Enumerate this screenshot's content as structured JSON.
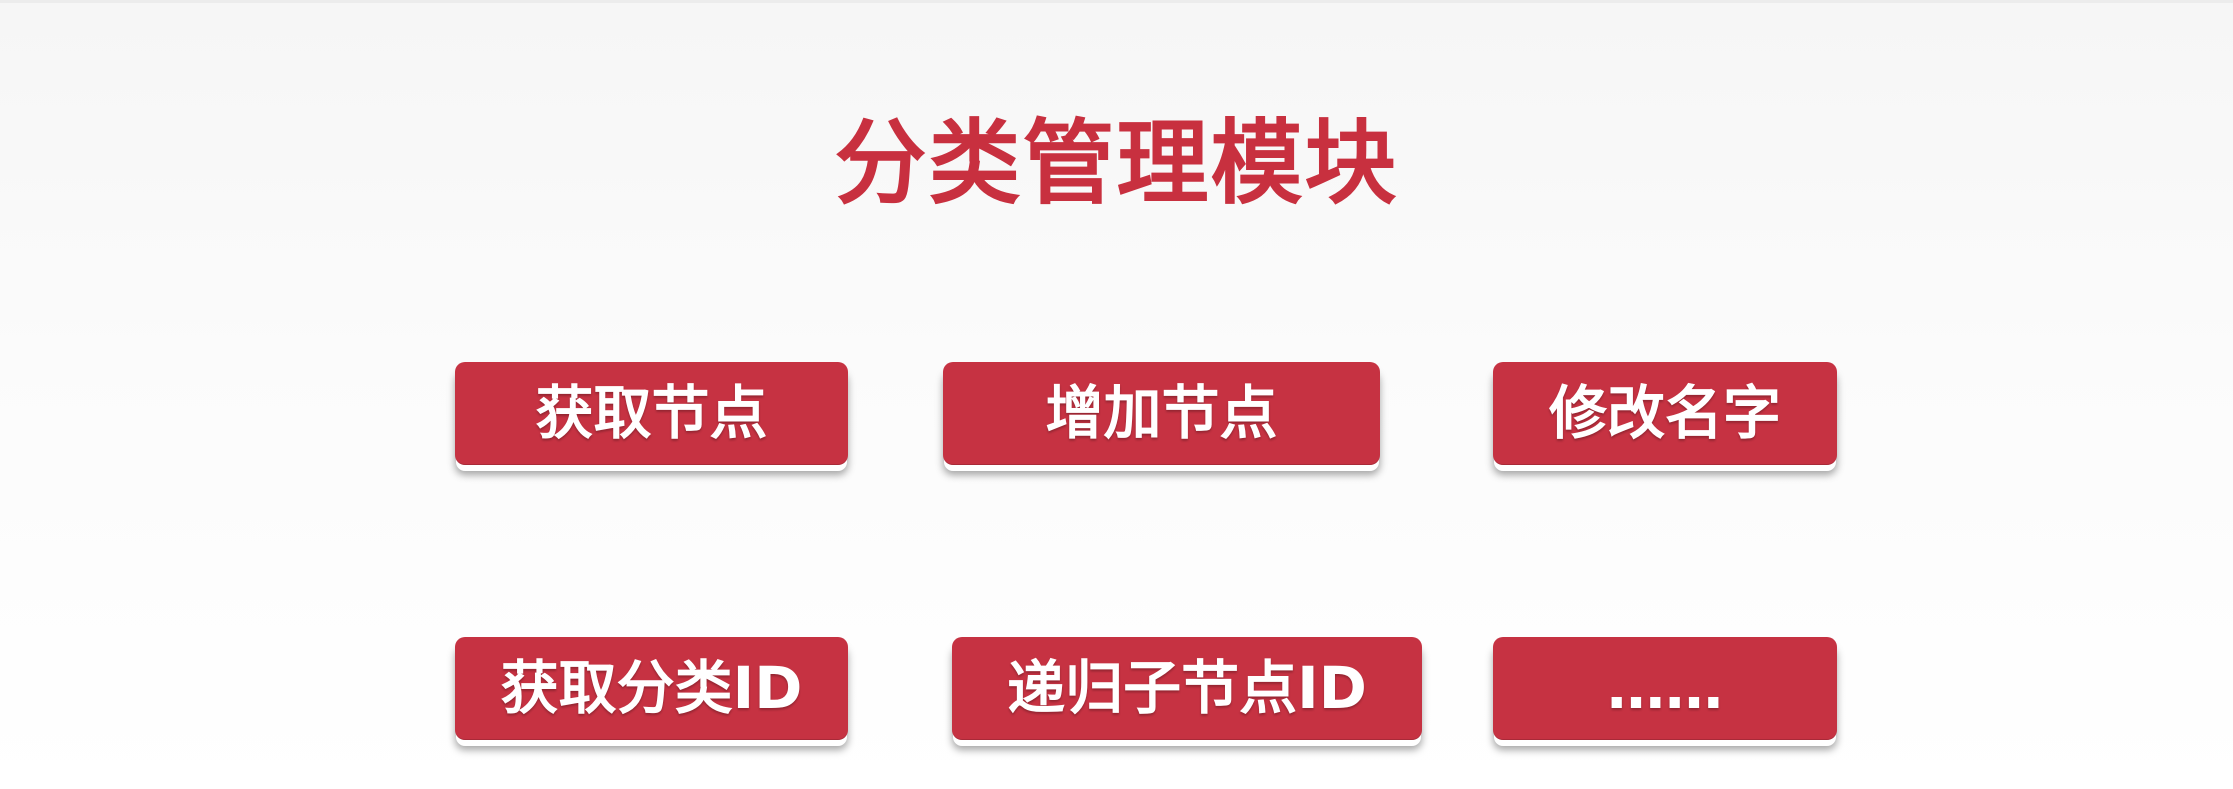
{
  "theme": {
    "accent": "#c63242",
    "title_color": "#c8303f"
  },
  "title": "分类管理模块",
  "items": [
    {
      "label": "获取节点"
    },
    {
      "label": "增加节点"
    },
    {
      "label": "修改名字"
    },
    {
      "label": "获取分类ID"
    },
    {
      "label": "递归子节点ID"
    },
    {
      "label": "……"
    }
  ]
}
